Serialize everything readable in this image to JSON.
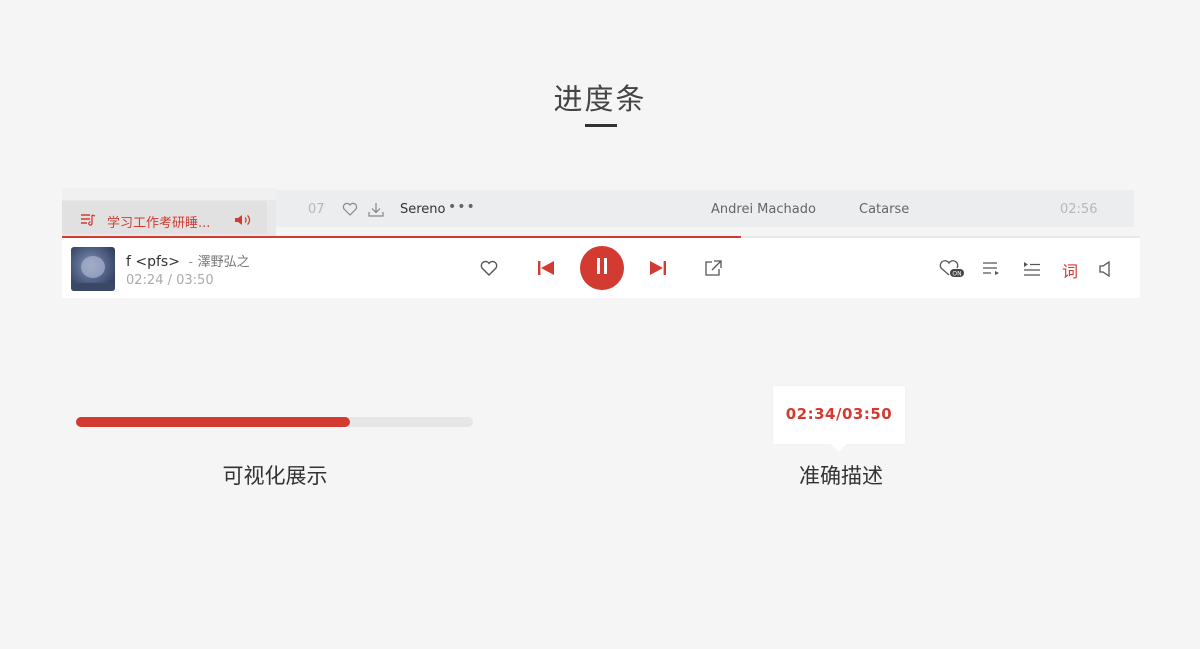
{
  "page": {
    "title": "进度条"
  },
  "colors": {
    "accent": "#d33a31",
    "background": "#f5f5f5",
    "muted": "#b8b8b8"
  },
  "track_row": {
    "number": "07",
    "song": "Sereno",
    "more": "•••",
    "artist": "Andrei Machado",
    "album": "Catarse",
    "duration": "02:56",
    "icons": [
      "heart-icon",
      "download-icon",
      "more-icon"
    ]
  },
  "sidebar": {
    "playing_list": "学习工作考研睡...",
    "icons": [
      "playlist-icon",
      "speaker-icon"
    ]
  },
  "player": {
    "song": "f <pfs>",
    "separator": "-",
    "artist": "澤野弘之",
    "elapsed": "02:24",
    "time_sep": " / ",
    "total": "03:50",
    "progress": 0.63,
    "lyric_label": "词",
    "icons": [
      "heart-icon",
      "previous-icon",
      "pause-icon",
      "next-icon",
      "share-icon",
      "heart-mode-icon",
      "play-order-icon",
      "queue-icon",
      "volume-icon"
    ]
  },
  "demo": {
    "progress": 0.69,
    "caption_left": "可视化展示",
    "tooltip_time": "02:34/03:50",
    "caption_right": "准确描述"
  }
}
